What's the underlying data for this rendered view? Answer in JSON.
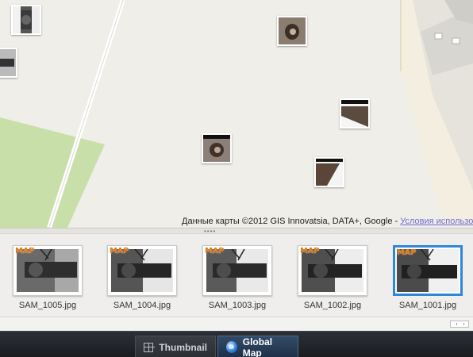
{
  "map": {
    "attribution": "Данные карты ©2012 GIS Innovatsia, DATA+, Google - ",
    "terms_link": "Условия использования",
    "pins": [
      {
        "name": "photo-pin-1"
      },
      {
        "name": "photo-pin-2"
      },
      {
        "name": "photo-pin-3"
      },
      {
        "name": "photo-pin-4"
      },
      {
        "name": "photo-pin-5"
      },
      {
        "name": "photo-pin-6"
      }
    ]
  },
  "filmstrip": {
    "badge": "MAP",
    "items": [
      {
        "label": "SAM_1005.jpg",
        "selected": false
      },
      {
        "label": "SAM_1004.jpg",
        "selected": false
      },
      {
        "label": "SAM_1003.jpg",
        "selected": false
      },
      {
        "label": "SAM_1002.jpg",
        "selected": false
      },
      {
        "label": "SAM_1001.jpg",
        "selected": true
      }
    ]
  },
  "tabs": {
    "thumbnail": {
      "label": "Thumbnail",
      "icon": "grid-icon",
      "active": false
    },
    "global_map": {
      "label": "Global Map",
      "icon": "globe-icon",
      "active": true
    }
  },
  "colors": {
    "selection": "#2f87d9",
    "badge": "#e07a10",
    "park": "#c8dfa7"
  }
}
